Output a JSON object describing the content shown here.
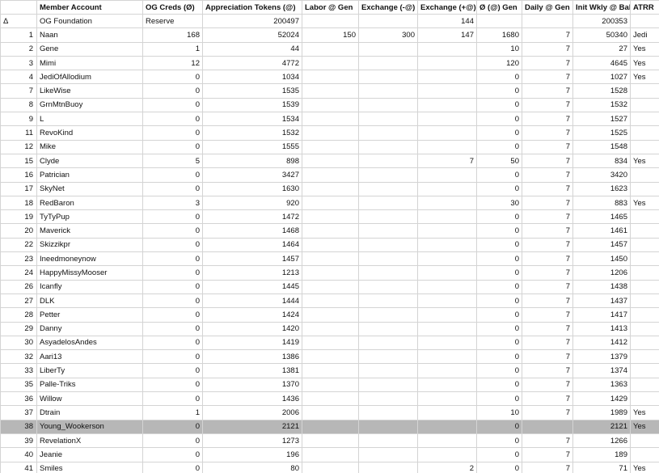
{
  "headers": [
    "",
    "Member Account",
    "OG Creds (Ø)",
    "Appreciation Tokens (@)",
    "Labor @ Gen",
    "Exchange (-@)",
    "Exchange (+@)",
    "Ø (@) Gen",
    "Daily @ Gen",
    "Init Wkly @ Bal",
    "ATRR"
  ],
  "foundation_row": [
    "Δ",
    "OG Foundation",
    "Reserve",
    "200497",
    "",
    "",
    "144",
    "",
    "",
    "200353",
    ""
  ],
  "rows": [
    [
      "1",
      "Naan",
      "168",
      "52024",
      "150",
      "300",
      "147",
      "1680",
      "7",
      "50340",
      "Jedi"
    ],
    [
      "2",
      "Gene",
      "1",
      "44",
      "",
      "",
      "",
      "10",
      "7",
      "27",
      "Yes"
    ],
    [
      "3",
      "Mimi",
      "12",
      "4772",
      "",
      "",
      "",
      "120",
      "7",
      "4645",
      "Yes"
    ],
    [
      "4",
      "JediOfAllodium",
      "0",
      "1034",
      "",
      "",
      "",
      "0",
      "7",
      "1027",
      "Yes"
    ],
    [
      "7",
      "LikeWise",
      "0",
      "1535",
      "",
      "",
      "",
      "0",
      "7",
      "1528",
      ""
    ],
    [
      "8",
      "GrnMtnBuoy",
      "0",
      "1539",
      "",
      "",
      "",
      "0",
      "7",
      "1532",
      ""
    ],
    [
      "9",
      "L",
      "0",
      "1534",
      "",
      "",
      "",
      "0",
      "7",
      "1527",
      ""
    ],
    [
      "11",
      "RevoKind",
      "0",
      "1532",
      "",
      "",
      "",
      "0",
      "7",
      "1525",
      ""
    ],
    [
      "12",
      "Mike",
      "0",
      "1555",
      "",
      "",
      "",
      "0",
      "7",
      "1548",
      ""
    ],
    [
      "15",
      "Clyde",
      "5",
      "898",
      "",
      "",
      "7",
      "50",
      "7",
      "834",
      "Yes"
    ],
    [
      "16",
      "Patrician",
      "0",
      "3427",
      "",
      "",
      "",
      "0",
      "7",
      "3420",
      ""
    ],
    [
      "17",
      "SkyNet",
      "0",
      "1630",
      "",
      "",
      "",
      "0",
      "7",
      "1623",
      ""
    ],
    [
      "18",
      "RedBaron",
      "3",
      "920",
      "",
      "",
      "",
      "30",
      "7",
      "883",
      "Yes"
    ],
    [
      "19",
      "TyTyPup",
      "0",
      "1472",
      "",
      "",
      "",
      "0",
      "7",
      "1465",
      ""
    ],
    [
      "20",
      "Maverick",
      "0",
      "1468",
      "",
      "",
      "",
      "0",
      "7",
      "1461",
      ""
    ],
    [
      "22",
      "Skizzikpr",
      "0",
      "1464",
      "",
      "",
      "",
      "0",
      "7",
      "1457",
      ""
    ],
    [
      "23",
      "Ineedmoneynow",
      "0",
      "1457",
      "",
      "",
      "",
      "0",
      "7",
      "1450",
      ""
    ],
    [
      "24",
      "HappyMissyMooser",
      "0",
      "1213",
      "",
      "",
      "",
      "0",
      "7",
      "1206",
      ""
    ],
    [
      "26",
      "Icanfly",
      "0",
      "1445",
      "",
      "",
      "",
      "0",
      "7",
      "1438",
      ""
    ],
    [
      "27",
      "DLK",
      "0",
      "1444",
      "",
      "",
      "",
      "0",
      "7",
      "1437",
      ""
    ],
    [
      "28",
      "Petter",
      "0",
      "1424",
      "",
      "",
      "",
      "0",
      "7",
      "1417",
      ""
    ],
    [
      "29",
      "Danny",
      "0",
      "1420",
      "",
      "",
      "",
      "0",
      "7",
      "1413",
      ""
    ],
    [
      "30",
      "AsyadelosAndes",
      "0",
      "1419",
      "",
      "",
      "",
      "0",
      "7",
      "1412",
      ""
    ],
    [
      "32",
      "Aari13",
      "0",
      "1386",
      "",
      "",
      "",
      "0",
      "7",
      "1379",
      ""
    ],
    [
      "33",
      "LiberTy",
      "0",
      "1381",
      "",
      "",
      "",
      "0",
      "7",
      "1374",
      ""
    ],
    [
      "35",
      "Palle-Triks",
      "0",
      "1370",
      "",
      "",
      "",
      "0",
      "7",
      "1363",
      ""
    ],
    [
      "36",
      "Willow",
      "0",
      "1436",
      "",
      "",
      "",
      "0",
      "7",
      "1429",
      ""
    ],
    [
      "37",
      "Dtrain",
      "1",
      "2006",
      "",
      "",
      "",
      "10",
      "7",
      "1989",
      "Yes"
    ],
    [
      "38",
      "Young_Wookerson",
      "0",
      "2121",
      "",
      "",
      "",
      "0",
      "",
      "2121",
      "Yes"
    ],
    [
      "39",
      "RevelationX",
      "0",
      "1273",
      "",
      "",
      "",
      "0",
      "7",
      "1266",
      ""
    ],
    [
      "40",
      "Jeanie",
      "0",
      "196",
      "",
      "",
      "",
      "0",
      "7",
      "189",
      ""
    ],
    [
      "41",
      "Smiles",
      "0",
      "80",
      "",
      "",
      "2",
      "0",
      "7",
      "71",
      "Yes"
    ]
  ],
  "selected_row_index": 28,
  "colors": {
    "grid": "#d4d4d4",
    "selected": "#b7b7b7",
    "divider": "#555555"
  }
}
